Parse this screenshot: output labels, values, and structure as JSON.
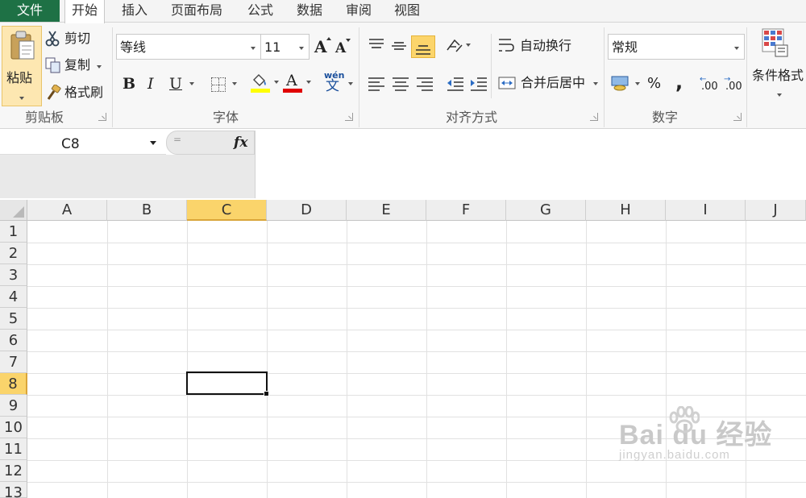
{
  "tabs": {
    "file": "文件",
    "items": [
      "开始",
      "插入",
      "页面布局",
      "公式",
      "数据",
      "审阅",
      "视图"
    ],
    "active": "开始"
  },
  "clipboard": {
    "paste": "粘贴",
    "cut": "剪切",
    "copy": "复制",
    "format_painter": "格式刷",
    "label": "剪贴板"
  },
  "font": {
    "name": "等线",
    "size": "11",
    "grow": "A",
    "shrink": "A",
    "bold": "B",
    "italic": "I",
    "underline": "U",
    "font_color_glyph": "A",
    "phonetic_top": "wén",
    "phonetic_bottom": "文",
    "label": "字体",
    "highlight_color": "#ffff00",
    "font_color": "#e00000"
  },
  "alignment": {
    "wrap_text": "自动换行",
    "merge_center": "合并后居中",
    "label": "对齐方式"
  },
  "number": {
    "format": "常规",
    "percent": "%",
    "comma": ",",
    "inc_decimal": ".00",
    "dec_decimal": ".00",
    "label": "数字"
  },
  "styles": {
    "conditional_format": "条件格式"
  },
  "formula_bar": {
    "name_box": "C8",
    "fx": "fx",
    "eq": "="
  },
  "sheet": {
    "columns": [
      "A",
      "B",
      "C",
      "D",
      "E",
      "F",
      "G",
      "H",
      "I",
      "J"
    ],
    "rows": [
      "1",
      "2",
      "3",
      "4",
      "5",
      "6",
      "7",
      "8",
      "9",
      "10",
      "11",
      "12",
      "13"
    ],
    "active_column": "C",
    "active_row": "8"
  },
  "watermark": {
    "main": "Bai du 经验",
    "sub": "jingyan.baidu.com"
  },
  "colors": {
    "file_tab": "#1e7145",
    "active_header": "#fad46b",
    "selected_button": "#fcd56b"
  }
}
